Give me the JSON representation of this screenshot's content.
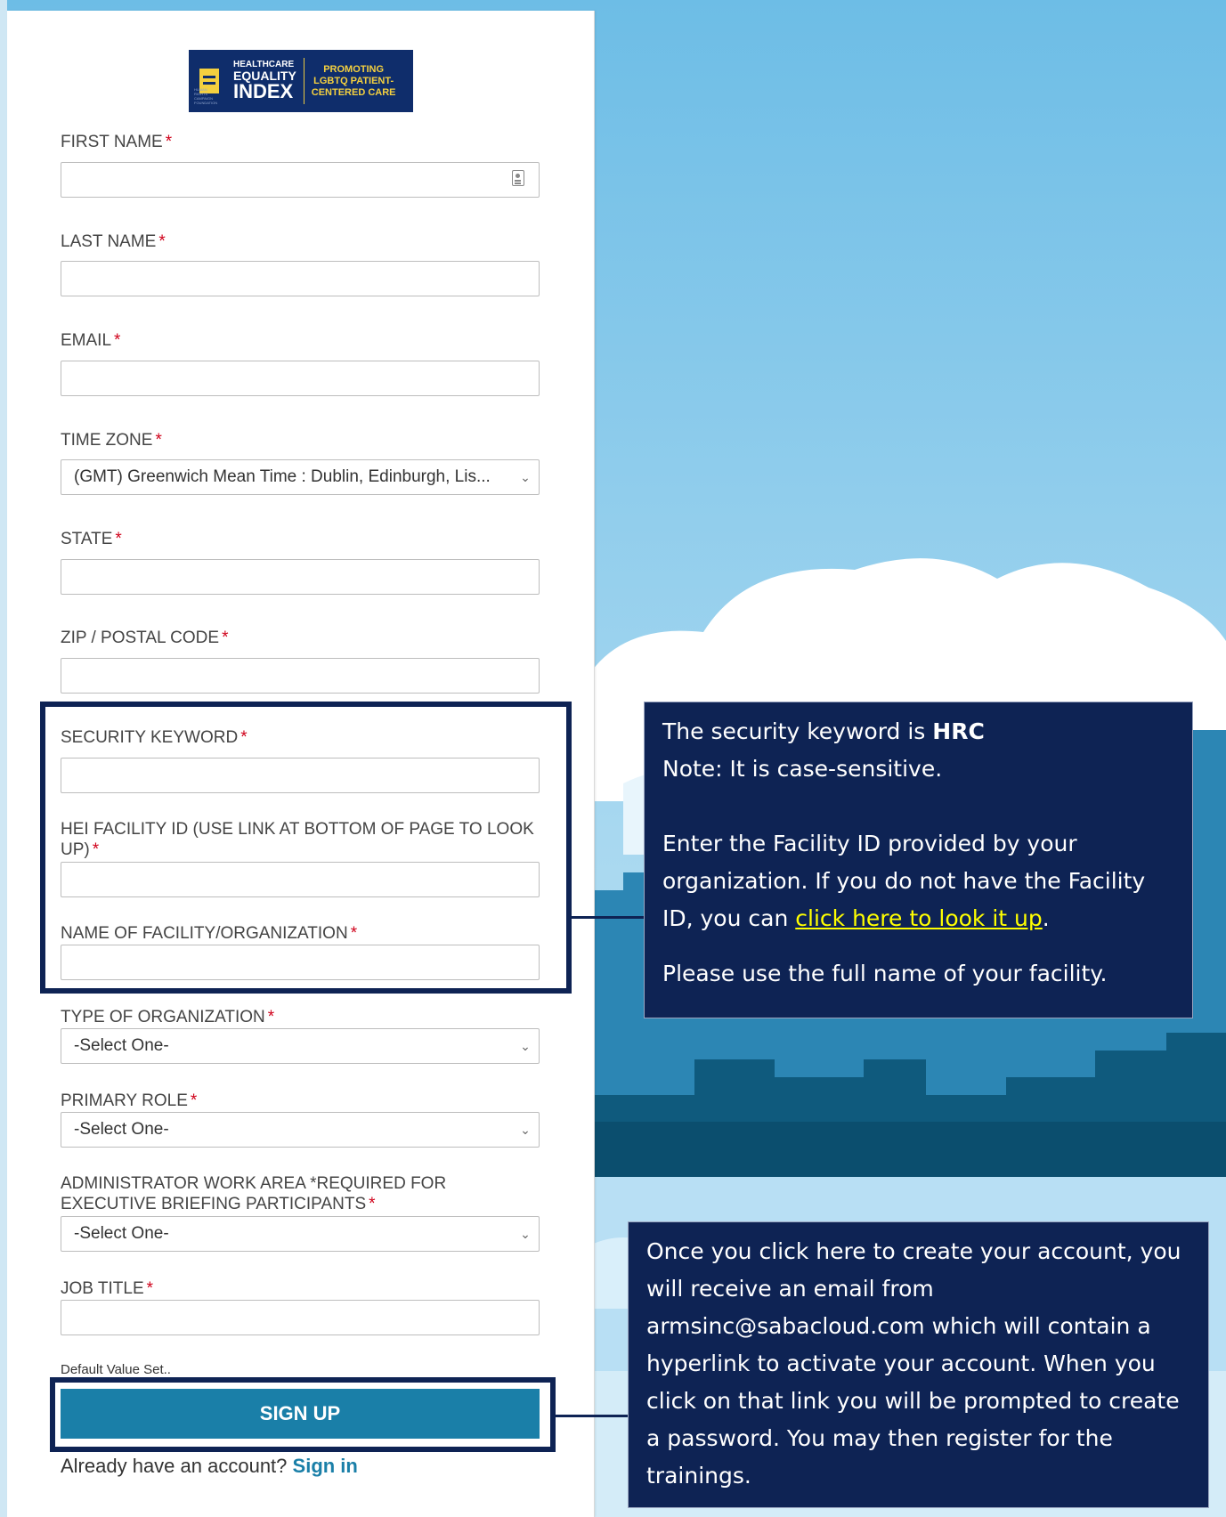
{
  "logo": {
    "line1": "HEALTHCARE",
    "line2": "EQUALITY",
    "line3": "INDEX",
    "tagline": [
      "PROMOTING",
      "LGBTQ PATIENT-",
      "CENTERED CARE"
    ],
    "small_text": "HUMAN RIGHTS CAMPAIGN FOUNDATION"
  },
  "form": {
    "first_name_label": "FIRST NAME",
    "last_name_label": "LAST NAME",
    "email_label": "EMAIL",
    "time_zone_label": "TIME ZONE",
    "time_zone_value": "(GMT) Greenwich Mean Time : Dublin, Edinburgh, Lis...",
    "state_label": "STATE",
    "zip_label": "ZIP / POSTAL CODE",
    "security_keyword_label": "SECURITY KEYWORD",
    "facility_id_label": "HEI FACILITY ID (USE LINK AT BOTTOM OF PAGE TO LOOK UP)",
    "facility_name_label": "NAME OF FACILITY/ORGANIZATION",
    "org_type_label": "TYPE OF ORGANIZATION",
    "org_type_value": "-Select One-",
    "primary_role_label": "PRIMARY ROLE",
    "primary_role_value": "-Select One-",
    "admin_area_label": "ADMINISTRATOR WORK AREA *REQUIRED FOR EXECUTIVE BRIEFING PARTICIPANTS",
    "admin_area_value": "-Select One-",
    "job_title_label": "JOB TITLE",
    "required_mark": "*",
    "default_note": "Default Value Set..",
    "signup_label": "SIGN UP",
    "already_text": "Already have an account?",
    "signin_label": "Sign in"
  },
  "callout_security": {
    "line1_prefix": "The security keyword is ",
    "keyword": "HRC",
    "line2": "Note: It is case-sensitive.",
    "para2_prefix": "Enter the Facility ID provided by your organization.  If you do not have the Facility ID, you can ",
    "link": "click here to look it up",
    "para2_suffix": ".",
    "para3": "Please use the full name of your facility."
  },
  "callout_signup": {
    "text": "Once you click here to create your account, you will receive an email from armsinc@sabacloud.com which will contain a hyperlink to activate your account. When you click on that link you will be prompted to create a password.  You may then register for the trainings."
  },
  "colors": {
    "navy": "#0e2354",
    "button": "#1a7fa8",
    "required": "#d0021b",
    "link_yellow": "#ffff00"
  }
}
